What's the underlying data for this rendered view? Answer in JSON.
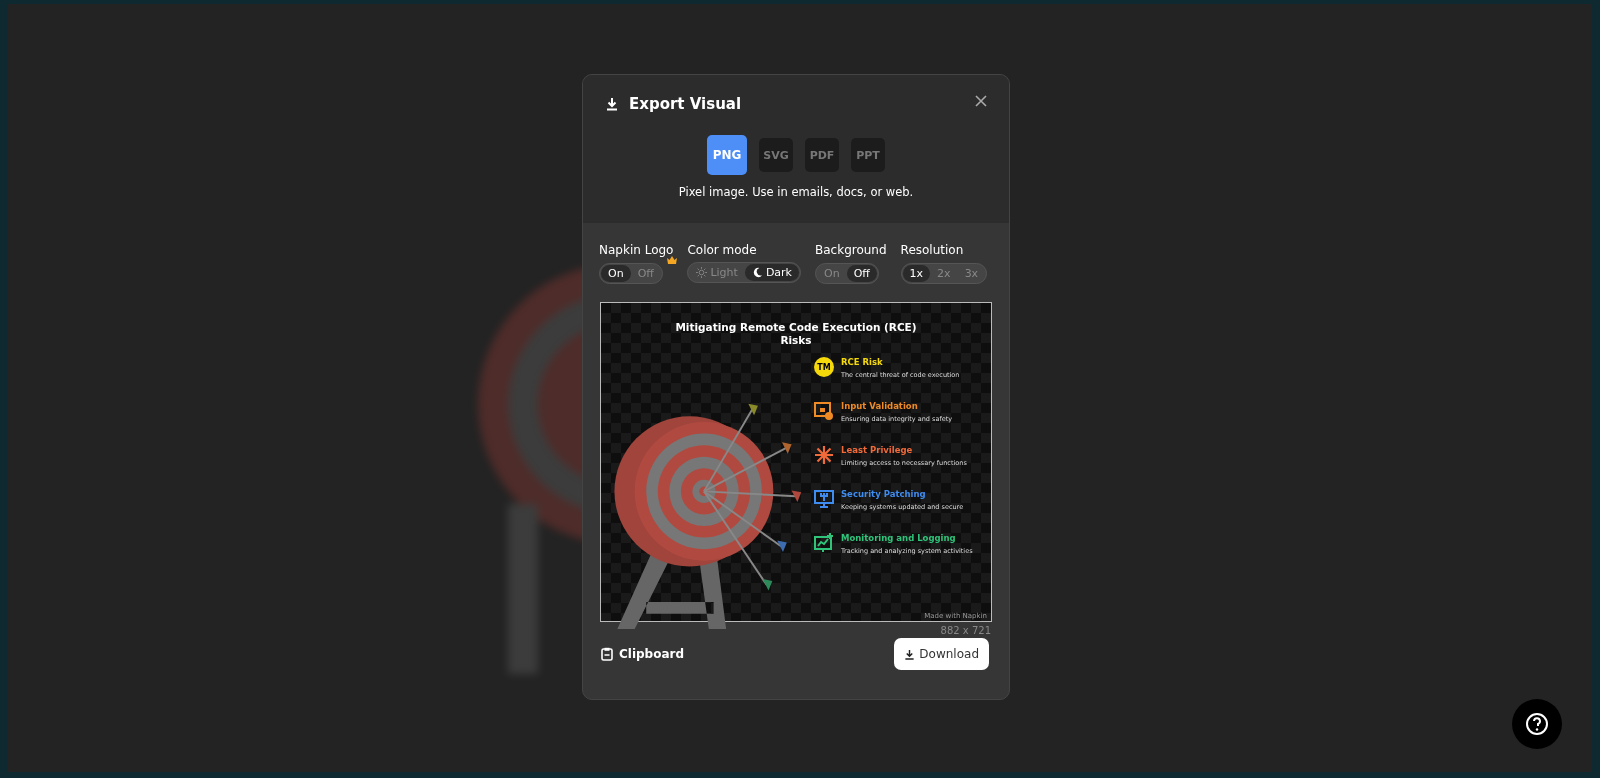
{
  "dialog": {
    "title": "Export Visual",
    "formats": [
      {
        "label": "PNG",
        "selected": true
      },
      {
        "label": "SVG",
        "selected": false
      },
      {
        "label": "PDF",
        "selected": false
      },
      {
        "label": "PPT",
        "selected": false
      }
    ],
    "format_description": "Pixel image. Use in emails, docs, or web.",
    "options": [
      {
        "label": "Napkin Logo",
        "premium": true,
        "choices": [
          {
            "label": "On",
            "selected": true
          },
          {
            "label": "Off",
            "selected": false
          }
        ]
      },
      {
        "label": "Color mode",
        "premium": false,
        "choices": [
          {
            "label": "Light",
            "kind": "sun",
            "selected": false
          },
          {
            "label": "Dark",
            "kind": "moon",
            "selected": true
          }
        ]
      },
      {
        "label": "Background",
        "premium": false,
        "choices": [
          {
            "label": "On",
            "selected": false
          },
          {
            "label": "Off",
            "selected": true
          }
        ]
      },
      {
        "label": "Resolution",
        "premium": false,
        "choices": [
          {
            "label": "1x",
            "selected": true
          },
          {
            "label": "2x",
            "selected": false
          },
          {
            "label": "3x",
            "selected": false
          }
        ]
      }
    ],
    "preview": {
      "title": "Mitigating Remote Code Execution (RCE) Risks",
      "items": [
        {
          "title": "RCE Risk",
          "description": "The central threat of code execution",
          "color": "#f5d90a",
          "kind": "badge",
          "icon_text": "TM"
        },
        {
          "title": "Input Validation",
          "description": "Ensuring data integrity and safety",
          "color": "#f08a24",
          "kind": "form"
        },
        {
          "title": "Least Privilege",
          "description": "Limiting access to necessary functions",
          "color": "#f06a3a",
          "kind": "burst"
        },
        {
          "title": "Security Patching",
          "description": "Keeping systems updated and secure",
          "color": "#3f8cf0",
          "kind": "monitor-wrench"
        },
        {
          "title": "Monitoring and Logging",
          "description": "Tracking and analyzing system activities",
          "color": "#2fc47a",
          "kind": "monitor-chart"
        }
      ],
      "credit": "Made with Napkin"
    },
    "image_size": "882 x 721",
    "clipboard_label": "Clipboard",
    "download_label": "Download"
  }
}
